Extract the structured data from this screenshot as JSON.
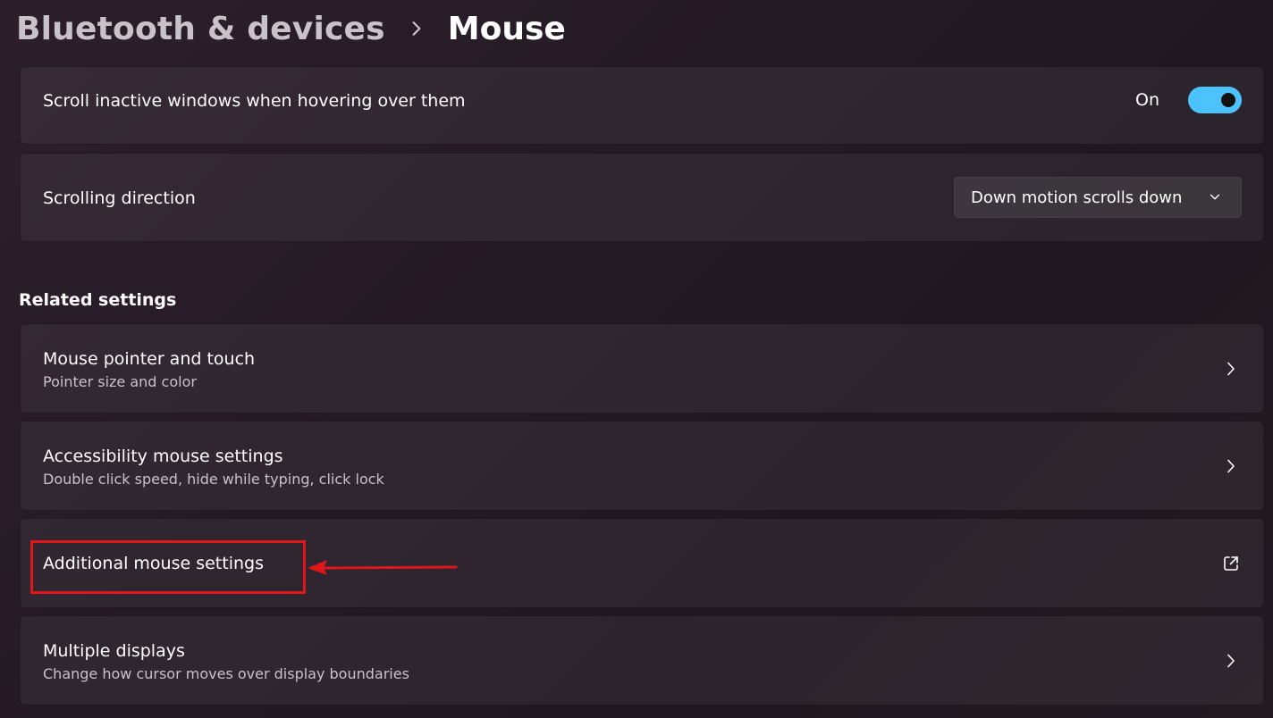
{
  "breadcrumb": {
    "parent": "Bluetooth & devices",
    "current": "Mouse"
  },
  "settings": {
    "scroll_inactive": {
      "label": "Scroll inactive windows when hovering over them",
      "state_label": "On",
      "enabled": true
    },
    "scrolling_direction": {
      "label": "Scrolling direction",
      "selected": "Down motion scrolls down"
    }
  },
  "related": {
    "header": "Related settings",
    "items": [
      {
        "title": "Mouse pointer and touch",
        "subtitle": "Pointer size and color",
        "icon": "chevron-right-icon"
      },
      {
        "title": "Accessibility mouse settings",
        "subtitle": "Double click speed, hide while typing, click lock",
        "icon": "chevron-right-icon"
      },
      {
        "title": "Additional mouse settings",
        "subtitle": "",
        "icon": "external-link-icon"
      },
      {
        "title": "Multiple displays",
        "subtitle": "Change how cursor moves over display boundaries",
        "icon": "chevron-right-icon"
      }
    ]
  },
  "colors": {
    "accent": "#4cc2ff",
    "annotation": "#e0161b"
  }
}
